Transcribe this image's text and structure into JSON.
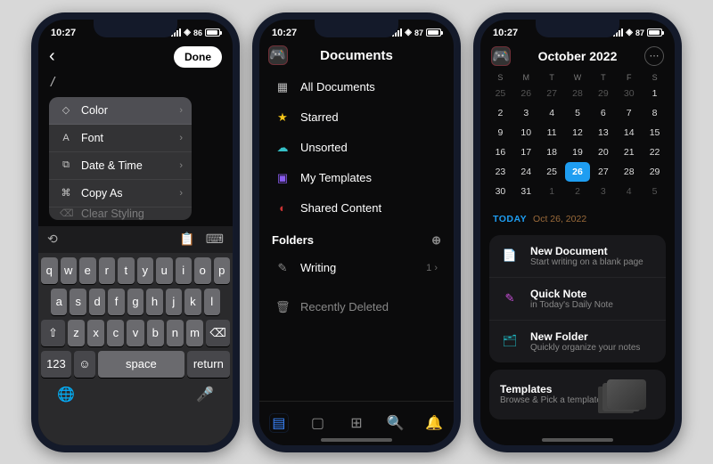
{
  "status": {
    "time": "10:27",
    "battery1": "86",
    "battery2": "87",
    "battery3": "87"
  },
  "p1": {
    "done": "Done",
    "slash": "/",
    "menu": [
      {
        "icon": "◇",
        "label": "Color",
        "chev": true,
        "sel": true
      },
      {
        "icon": "A",
        "label": "Font",
        "chev": true
      },
      {
        "icon": "⧉",
        "label": "Date & Time",
        "chev": true
      },
      {
        "icon": "⌘",
        "label": "Copy As",
        "chev": true
      },
      {
        "icon": "⌫",
        "label": "Clear Styling",
        "chev": false
      }
    ],
    "kb": {
      "r1": [
        "q",
        "w",
        "e",
        "r",
        "t",
        "y",
        "u",
        "i",
        "o",
        "p"
      ],
      "r2": [
        "a",
        "s",
        "d",
        "f",
        "g",
        "h",
        "j",
        "k",
        "l"
      ],
      "r3": [
        "⇧",
        "z",
        "x",
        "c",
        "v",
        "b",
        "n",
        "m",
        "⌫"
      ],
      "r4_123": "123",
      "r4_space": "space",
      "r4_return": "return"
    }
  },
  "p2": {
    "title": "Documents",
    "items": [
      {
        "ic": "▦",
        "label": "All Documents",
        "c": "#bbb"
      },
      {
        "ic": "★",
        "label": "Starred",
        "c": "#f5c518"
      },
      {
        "ic": "☁",
        "label": "Unsorted",
        "c": "#35c0c7"
      },
      {
        "ic": "▣",
        "label": "My Templates",
        "c": "#8a5cf0"
      },
      {
        "ic": "◐",
        "label": "Shared Content",
        "c": "#c33"
      }
    ],
    "folders_label": "Folders",
    "folders": [
      {
        "ic": "✎",
        "label": "Writing",
        "meta": "1  ›"
      }
    ],
    "trash": {
      "ic": "🗑",
      "label": "Recently Deleted"
    }
  },
  "p3": {
    "month": "October 2022",
    "wk": [
      "S",
      "M",
      "T",
      "W",
      "T",
      "F",
      "S"
    ],
    "pre": [
      25,
      26,
      27,
      28,
      29,
      30
    ],
    "days": 31,
    "post": [
      1,
      2,
      3,
      4,
      5
    ],
    "today": 26,
    "today_label": "TODAY",
    "today_date": "Oct 26, 2022",
    "cards": [
      {
        "ic": "📄",
        "c": "#1e9df1",
        "t": "New Document",
        "s": "Start writing on a blank page"
      },
      {
        "ic": "✎",
        "c": "#c84fd8",
        "t": "Quick Note",
        "s": "in Today's Daily Note"
      },
      {
        "ic": "🗂",
        "c": "#1fb6c1",
        "t": "New Folder",
        "s": "Quickly organize your notes"
      }
    ],
    "tmpl": {
      "t": "Templates",
      "s": "Browse & Pick a template"
    }
  }
}
